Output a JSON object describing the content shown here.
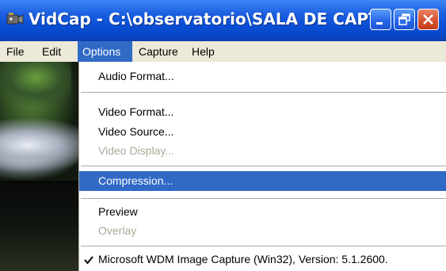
{
  "window": {
    "title": "VidCap - C:\\observatorio\\SALA DE CAPTUR...",
    "icon": "vidcap-camera-icon",
    "buttons": [
      "minimize-icon",
      "restore-icon",
      "close-icon"
    ]
  },
  "menubar": {
    "items": [
      {
        "label": "File"
      },
      {
        "label": "Edit"
      },
      {
        "label": "Options",
        "active": true
      },
      {
        "label": "Capture"
      },
      {
        "label": "Help"
      }
    ]
  },
  "options_menu": {
    "items": [
      {
        "label": "Audio Format...",
        "enabled": true
      },
      {
        "separator": true
      },
      {
        "label": "Video Format...",
        "enabled": true
      },
      {
        "label": "Video Source...",
        "enabled": true
      },
      {
        "label": "Video Display...",
        "enabled": false
      },
      {
        "separator": true
      },
      {
        "label": "Compression...",
        "enabled": true,
        "highlighted": true
      },
      {
        "separator": true
      },
      {
        "label": "Preview",
        "enabled": true
      },
      {
        "label": "Overlay",
        "enabled": false
      },
      {
        "separator": true
      },
      {
        "label": "Microsoft WDM Image Capture (Win32),   Version:  5.1.2600.",
        "enabled": true,
        "checked": true
      }
    ]
  },
  "colors": {
    "titlebar": "#0a4fd6",
    "menubar": "#ece9d8",
    "highlight": "#316ac5",
    "disabled_text": "#aca899",
    "close_button": "#d8532f"
  }
}
